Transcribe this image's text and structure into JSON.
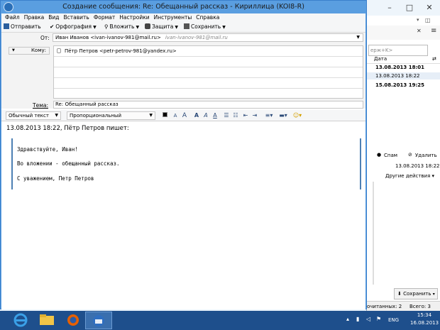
{
  "compose_window": {
    "title": "Создание сообщения: Re: Обещанный рассказ - Кириллица (KOI8-R)",
    "menu": [
      "Файл",
      "Правка",
      "Вид",
      "Вставить",
      "Формат",
      "Настройки",
      "Инструменты",
      "Справка"
    ],
    "toolbar": {
      "send": "Отправить",
      "spelling": "Орфография",
      "attach": "Вложить",
      "security": "Защита",
      "save": "Сохранить"
    },
    "headers": {
      "from_label": "От:",
      "from_value": "Иван Иванов <ivan-ivanov-981@mail.ru>",
      "from_alt": "ivan-ivanov-981@mail.ru",
      "recipient_type": "Кому:",
      "recipient": "Пётр Петров <petr-petrov-981@yandex.ru>",
      "subject_label": "Тема:",
      "subject_value": "Re: Обещанный рассказ"
    },
    "format_bar": {
      "paragraph_format": "Обычный текст",
      "font": "Пропорциональный"
    },
    "body": {
      "attribution": "13.08.2013 18:22, Пётр Петров пишет:",
      "quoted_lines": [
        "Здравствуйте, Иван!",
        "Во вложении - обещанный рассказ.",
        "С уважением, Петр Петров"
      ]
    }
  },
  "main_window": {
    "search_hint": "ерж+K>",
    "date_column": "Дата",
    "message_dates": [
      "13.08.2013 18:01",
      "13.08.2013 18:22",
      "15.08.2013 19:25"
    ],
    "msg_toolbar": {
      "spam": "Спам",
      "delete": "Удалить"
    },
    "message_date": "13.08.2013 18:22",
    "other_actions": "Другие действия",
    "save_button": "Сохранить",
    "status": {
      "unread": "очитанных: 2",
      "total": "Всего: 3"
    }
  },
  "taskbar": {
    "clock_time": "15:34",
    "clock_date": "16.08.2013",
    "language": "ENG"
  }
}
